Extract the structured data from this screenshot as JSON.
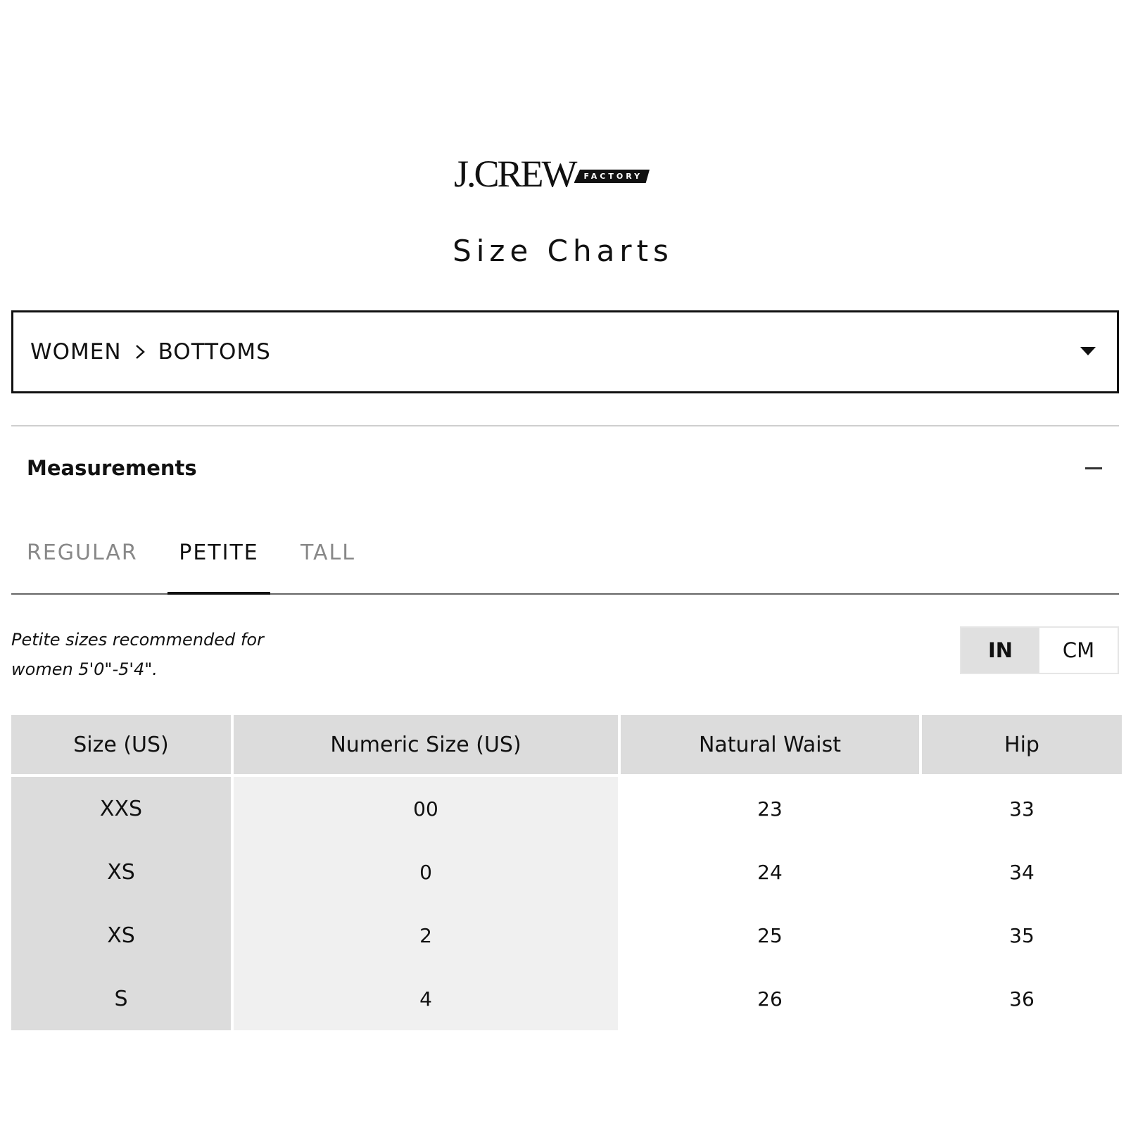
{
  "brand": {
    "wordmark": "J.CREW",
    "badge": "FACTORY"
  },
  "page_title": "Size Charts",
  "category": {
    "level1": "WOMEN",
    "level2": "BOTTOMS"
  },
  "section": {
    "title": "Measurements"
  },
  "tabs": [
    {
      "label": "REGULAR",
      "active": false
    },
    {
      "label": "PETITE",
      "active": true
    },
    {
      "label": "TALL",
      "active": false
    }
  ],
  "note": "Petite sizes recommended for women 5'0\"-5'4\".",
  "units": [
    {
      "label": "IN",
      "active": true
    },
    {
      "label": "CM",
      "active": false
    }
  ],
  "table": {
    "headers": [
      "Size (US)",
      "Numeric Size (US)",
      "Natural Waist",
      "Hip"
    ],
    "rows": [
      [
        "XXS",
        "00",
        "23",
        "33"
      ],
      [
        "XS",
        "0",
        "24",
        "34"
      ],
      [
        "XS",
        "2",
        "25",
        "35"
      ],
      [
        "S",
        "4",
        "26",
        "36"
      ]
    ]
  }
}
